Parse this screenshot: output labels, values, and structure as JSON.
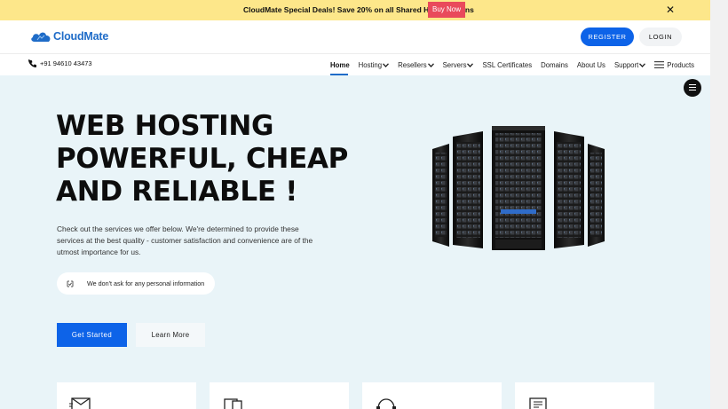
{
  "promo": {
    "text": "CloudMate Special Deals! Save 20% on all Shared Hosting Plans",
    "button": "Buy Now",
    "close": "✕"
  },
  "header": {
    "logo_text": "CloudMate",
    "register": "REGISTER",
    "login": "LOGIN",
    "phone": "+91 94610 43473"
  },
  "nav": {
    "items": [
      {
        "label": "Home",
        "dropdown": false,
        "active": true
      },
      {
        "label": "Hosting",
        "dropdown": true
      },
      {
        "label": "Resellers",
        "dropdown": true
      },
      {
        "label": "Servers",
        "dropdown": true
      },
      {
        "label": "SSL Certificates",
        "dropdown": false
      },
      {
        "label": "Domains",
        "dropdown": false
      },
      {
        "label": "About Us",
        "dropdown": false
      },
      {
        "label": "Support",
        "dropdown": true
      },
      {
        "label": "Products",
        "dropdown": false,
        "icon": "hamburger-icon"
      }
    ]
  },
  "hero": {
    "title_lines": [
      "WEB HOSTING",
      "POWERFUL, CHEAP",
      "AND RELIABLE !"
    ],
    "description": "Check out the services we offer below. We're determined to provide these services at the best quality - customer satisfaction and convenience are of the utmost importance for us.",
    "privacy_note": "We don't ask for any personal information",
    "get_started": "Get Started",
    "learn_more": "Learn More"
  },
  "cards": [
    {
      "icon": "mail-icon"
    },
    {
      "icon": "devices-icon"
    },
    {
      "icon": "support-icon"
    },
    {
      "icon": "invoice-icon"
    }
  ],
  "colors": {
    "promo_bg": "#fde78a",
    "buy_now": "#e94a5b",
    "primary": "#0d63e8",
    "brand": "#1f6cc8",
    "hero_bg": "#e9f4f8"
  }
}
